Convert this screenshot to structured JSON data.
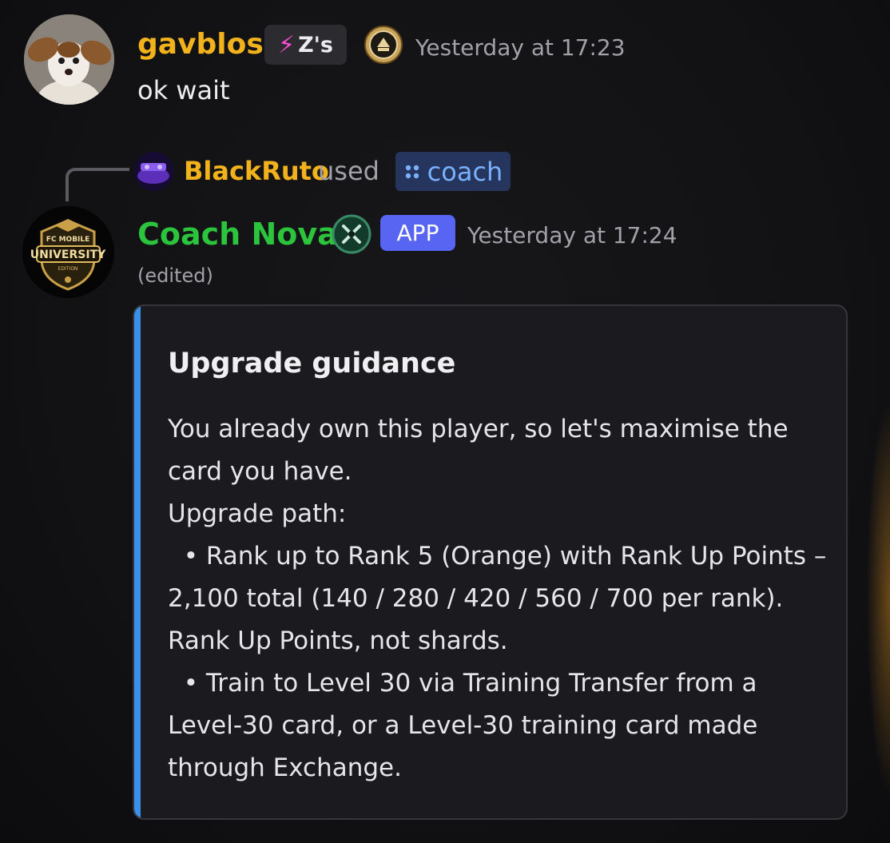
{
  "messages": [
    {
      "username": "gavblosi",
      "tag": {
        "icon": "lightning-bolt-icon",
        "label": "Z's"
      },
      "badge": "coin-badge-icon",
      "timestamp": "Yesterday at 17:23",
      "text": "ok wait"
    },
    {
      "reply": {
        "username": "BlackRuto",
        "used_label": "used",
        "command": "coach"
      },
      "username": "Coach Nova",
      "badge": "crossed-swords-icon",
      "app_badge": "APP",
      "timestamp": "Yesterday at 17:24",
      "edited": "(edited)",
      "embed": {
        "accent_color": "#3a8fe8",
        "title": "Upgrade guidance",
        "lines": [
          "You already own this player, so let's maximise the",
          "card you have.",
          "Upgrade path:",
          "  • Rank up to Rank 5 (Orange) with Rank Up Points –",
          "2,100 total (140 / 280 / 420 / 560 / 700 per rank).",
          "Rank Up Points, not shards.",
          "  • Train to Level 30 via Training Transfer from a",
          "Level-30 card, or a Level-30 training card made",
          "through Exchange."
        ]
      }
    }
  ],
  "colors": {
    "username_gold": "#f2b21b",
    "username_green": "#2cc33d",
    "app_badge": "#5865f2",
    "command_text": "#7ab1ff"
  },
  "avatars": {
    "first": "dog-avatar",
    "reply": "blackruto-avatar",
    "second": "fc-mobile-university-logo",
    "second_logo_text": [
      "FC MOBILE",
      "UNIVERSITY",
      "EDITION"
    ]
  }
}
